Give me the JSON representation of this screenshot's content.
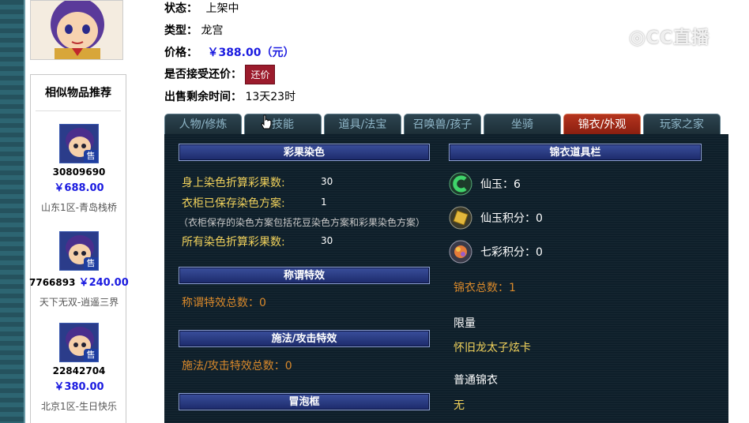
{
  "info": {
    "status_label": "状态：",
    "status_value": "上架中",
    "type_label": "类型：",
    "type_value": "龙宫",
    "price_label": "价格：",
    "price_value": "￥388.00（元）",
    "bargain_label": "是否接受还价：",
    "bargain_button": "还价",
    "remaining_label": "出售剩余时间：",
    "remaining_value": "13天23时"
  },
  "watermark": "CC直播",
  "similar": {
    "title": "相似物品推荐",
    "sell_badge": "售",
    "items": [
      {
        "id": "30809690",
        "price": "￥688.00",
        "server": "山东1区-青岛栈桥"
      },
      {
        "id": "7766893",
        "price": "￥240.00",
        "server": "天下无双-逍遥三界"
      },
      {
        "id": "22842704",
        "price": "￥380.00",
        "server": "北京1区-生日快乐"
      }
    ]
  },
  "tabs": [
    "人物/修炼",
    "技能",
    "道具/法宝",
    "召唤兽/孩子",
    "坐骑",
    "锦衣/外观",
    "玩家之家"
  ],
  "active_tab": "锦衣/外观",
  "left": {
    "dye_title": "彩果染色",
    "dye_body_label": "身上染色折算彩果数:",
    "dye_body_value": "30",
    "dye_wardrobe_label": "衣柜已保存染色方案:",
    "dye_wardrobe_value": "1",
    "dye_note": "（衣柜保存的染色方案包括花豆染色方案和彩果染色方案）",
    "dye_all_label": "所有染色折算彩果数:",
    "dye_all_value": "30",
    "title_effect_title": "称谓特效",
    "title_effect_total": "称谓特效总数：0",
    "cast_effect_title": "施法/攻击特效",
    "cast_effect_total": "施法/攻击特效总数：0",
    "bubble_title": "冒泡框"
  },
  "right": {
    "bar_title": "锦衣道具栏",
    "xianyu": "仙玉：6",
    "xianyu_points": "仙玉积分：0",
    "qicai_points": "七彩积分：0",
    "jinyi_total": "锦衣总数：1",
    "limited_label": "限量",
    "limited_item": "怀旧龙太子炫卡",
    "normal_label": "普通锦衣",
    "normal_item": "无"
  },
  "colors": {
    "tab_active": "#9b2a16",
    "panel_bg": "#0e1f2a",
    "yellow_text": "#f2d35c",
    "orange_text": "#d9892b",
    "price_blue": "#1a1ae0",
    "bargain_btn": "#9b1b2c"
  },
  "icons": [
    "avatar-portrait",
    "jade-icon",
    "jade-points-icon",
    "rainbow-points-icon",
    "mouse-cursor-icon"
  ]
}
